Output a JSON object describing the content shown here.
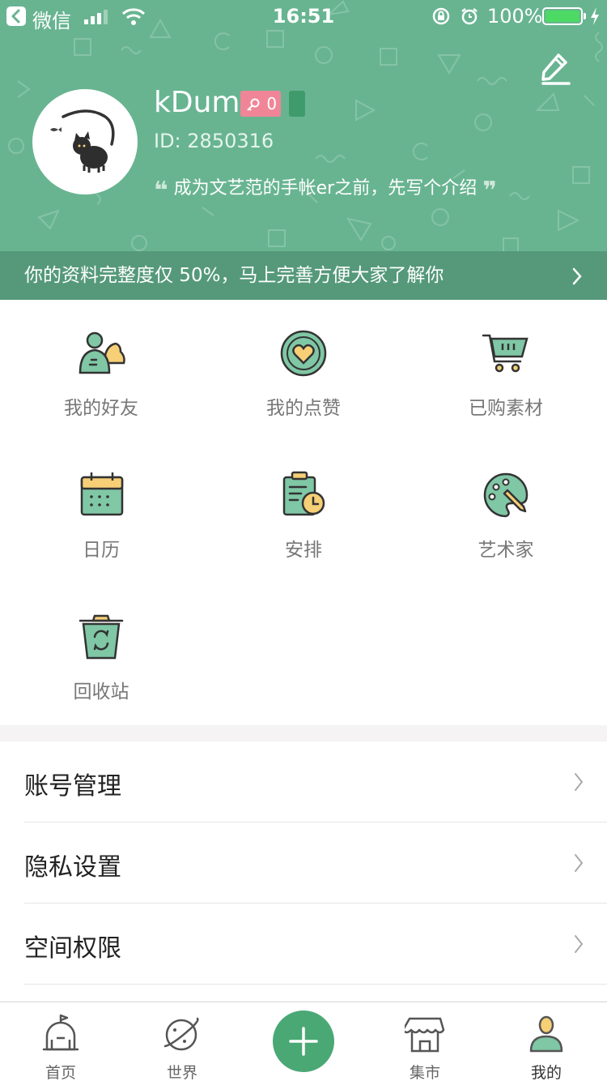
{
  "status_bar": {
    "back_app": "微信",
    "time": "16:51",
    "battery": "100%"
  },
  "profile": {
    "username": "kDum",
    "badge_count": "0",
    "user_id": "ID: 2850316",
    "intro": "成为文艺范的手帐er之前，先写个介绍",
    "quote_open": "❝",
    "quote_close": "❞"
  },
  "completion_banner": {
    "text": "你的资料完整度仅 50%，马上完善方便大家了解你"
  },
  "grid_items": [
    {
      "label": "我的好友",
      "icon": "friends-icon"
    },
    {
      "label": "我的点赞",
      "icon": "heart-like-icon"
    },
    {
      "label": "已购素材",
      "icon": "shopping-cart-icon"
    },
    {
      "label": "日历",
      "icon": "calendar-icon"
    },
    {
      "label": "安排",
      "icon": "schedule-clipboard-icon"
    },
    {
      "label": "艺术家",
      "icon": "artist-palette-icon"
    },
    {
      "label": "回收站",
      "icon": "recycle-bin-icon"
    }
  ],
  "settings": [
    {
      "label": "账号管理"
    },
    {
      "label": "隐私设置"
    },
    {
      "label": "空间权限"
    }
  ],
  "tabbar": {
    "home": "首页",
    "world": "世界",
    "market": "集市",
    "mine": "我的"
  },
  "colors": {
    "header_green": "#68b491",
    "banner_green": "#55997a",
    "accent_green": "#4aa875",
    "icon_mint": "#7fc7a5",
    "icon_yellow": "#f6cf76",
    "badge_pink": "#f08597"
  }
}
